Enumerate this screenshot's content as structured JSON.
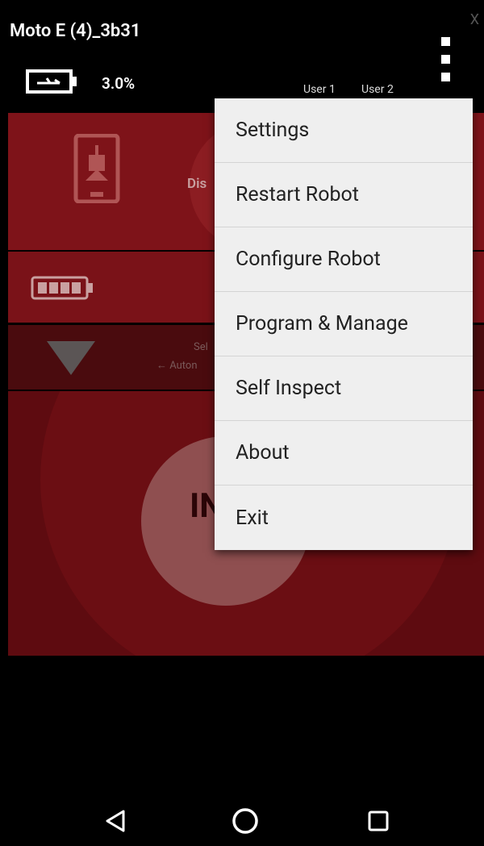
{
  "header": {
    "device_name": "Moto E (4)_3b31",
    "close_glyph": "X",
    "battery_percent": "3.0%",
    "battery_icon": "charging-battery-icon",
    "user_tabs": [
      "User 1",
      "User 2"
    ],
    "menu_icon": "overflow-menu-icon"
  },
  "app": {
    "phone_icon": "robot-phone-icon",
    "connection_button": "Dis",
    "robot_battery_icon": "robot-battery-icon",
    "op_mode_icon": "dropdown-triangle-icon",
    "op_mode_label": "Sel",
    "autonomous_label": "← Auton",
    "init_button": "IN"
  },
  "overflow_menu": {
    "items": [
      "Settings",
      "Restart Robot",
      "Configure Robot",
      "Program & Manage",
      "Self Inspect",
      "About",
      "Exit"
    ]
  },
  "nav_bar": {
    "back_icon": "back-triangle-icon",
    "home_icon": "home-circle-icon",
    "recents_icon": "recents-square-icon"
  },
  "colors": {
    "background": "#000000",
    "panel_red": "#7e1319",
    "menu_background": "#efefef",
    "menu_text": "#222222"
  }
}
